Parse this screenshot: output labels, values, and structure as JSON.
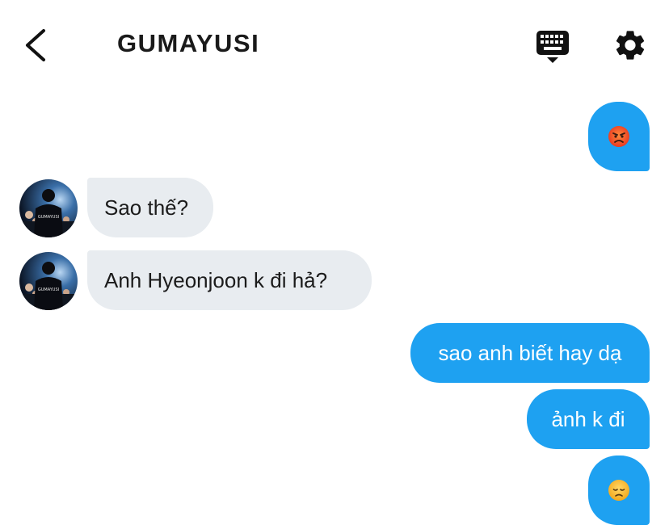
{
  "header": {
    "title": "GUMAYUSI",
    "back_icon": "chevron-left-icon",
    "keyboard_icon": "keyboard-icon",
    "settings_icon": "gear-icon"
  },
  "avatar": {
    "shirt_text": "GUMAYUSI"
  },
  "messages": [
    {
      "direction": "out",
      "kind": "emoji",
      "emoji": "angry-face"
    },
    {
      "direction": "in",
      "text": "Sao thế?"
    },
    {
      "direction": "in",
      "text": "Anh Hyeonjoon k đi hả?"
    },
    {
      "direction": "out",
      "text": "sao anh biết hay dạ"
    },
    {
      "direction": "out",
      "text": "ảnh k đi"
    },
    {
      "direction": "out",
      "kind": "emoji",
      "emoji": "disappointed-face"
    }
  ],
  "colors": {
    "outgoing_bubble": "#1ea1f1",
    "incoming_bubble": "#e8ecf0",
    "title_text": "#1a1a1a"
  }
}
